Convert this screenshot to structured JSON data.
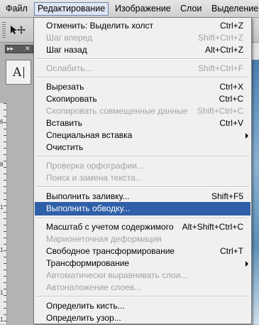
{
  "menubar": {
    "items": [
      "Файл",
      "Редактирование",
      "Изображение",
      "Слои",
      "Выделение"
    ]
  },
  "panel": {
    "collapse_glyph": "▸▸",
    "close_glyph": "✕",
    "char_glyph": "A"
  },
  "ruler": {
    "marks": [
      "6",
      "8",
      "1",
      "1",
      "1",
      "1"
    ]
  },
  "menu": {
    "undo": {
      "label": "Отменить: Выделить холст",
      "shortcut": "Ctrl+Z"
    },
    "step_forward": {
      "label": "Шаг вперед",
      "shortcut": "Shift+Ctrl+Z"
    },
    "step_back": {
      "label": "Шаг назад",
      "shortcut": "Alt+Ctrl+Z"
    },
    "fade": {
      "label": "Ослабить...",
      "shortcut": "Shift+Ctrl+F"
    },
    "cut": {
      "label": "Вырезать",
      "shortcut": "Ctrl+X"
    },
    "copy": {
      "label": "Скопировать",
      "shortcut": "Ctrl+C"
    },
    "copy_merged": {
      "label": "Скопировать совмещенные данные",
      "shortcut": "Shift+Ctrl+C"
    },
    "paste": {
      "label": "Вставить",
      "shortcut": "Ctrl+V"
    },
    "paste_special": {
      "label": "Специальная вставка"
    },
    "clear": {
      "label": "Очистить"
    },
    "check_spelling": {
      "label": "Проверка орфографии..."
    },
    "find_replace": {
      "label": "Поиск и замена текста..."
    },
    "fill": {
      "label": "Выполнить заливку...",
      "shortcut": "Shift+F5"
    },
    "stroke": {
      "label": "Выполнить обводку..."
    },
    "content_aware_scale": {
      "label": "Масштаб с учетом содержимого",
      "shortcut": "Alt+Shift+Ctrl+C"
    },
    "puppet_warp": {
      "label": "Марионеточная деформация"
    },
    "free_transform": {
      "label": "Свободное трансформирование",
      "shortcut": "Ctrl+T"
    },
    "transform": {
      "label": "Трансформирование"
    },
    "auto_align": {
      "label": "Автоматически выравнивать слои..."
    },
    "auto_blend": {
      "label": "Автоналожение слоев..."
    },
    "define_brush": {
      "label": "Определить кисть..."
    },
    "define_pattern": {
      "label": "Определить узор..."
    }
  }
}
